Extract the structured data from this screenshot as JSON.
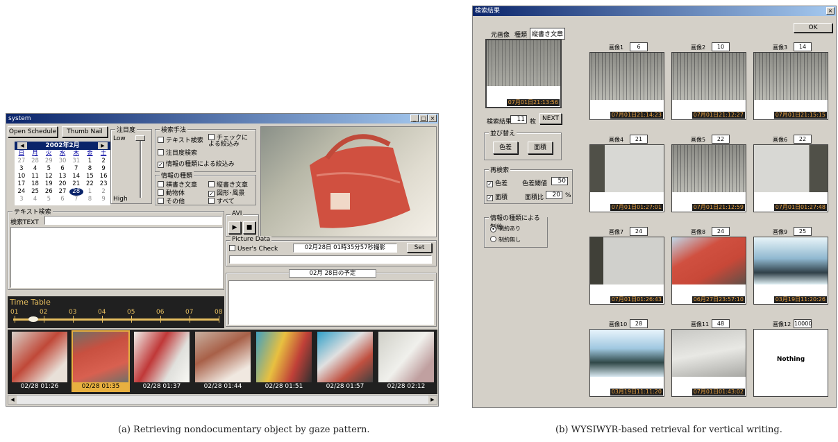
{
  "window_a": {
    "title": "system",
    "buttons": {
      "open_schedule": "Open Schedule",
      "thumb_nail": "Thumb Nail",
      "set": "Set"
    },
    "calendar": {
      "month": "2002年2月",
      "weekdays": [
        "日",
        "月",
        "火",
        "水",
        "木",
        "金",
        "土"
      ],
      "days": [
        "27",
        "28",
        "29",
        "30",
        "31",
        "1",
        "2",
        "3",
        "4",
        "5",
        "6",
        "7",
        "8",
        "9",
        "10",
        "11",
        "12",
        "13",
        "14",
        "15",
        "16",
        "17",
        "18",
        "19",
        "20",
        "21",
        "22",
        "23",
        "24",
        "25",
        "26",
        "27",
        "28",
        "1",
        "2",
        "3",
        "4",
        "5",
        "6",
        "7",
        "8",
        "9"
      ]
    },
    "attention": {
      "label": "注目度",
      "low": "Low",
      "high": "High"
    },
    "search_method": {
      "label": "検索手法",
      "text_search": "テキスト検索",
      "check_filter": "チェックに よる絞込み",
      "attention_search": "注目度検索",
      "info_type_filter": "情報の種類による絞込み"
    },
    "info_type": {
      "label": "情報の種類",
      "horizontal": "横書き文章",
      "vertical": "縦書き文章",
      "animal": "動物体",
      "figure": "図形･風景",
      "other": "その他",
      "all": "すべて"
    },
    "text_search": {
      "label": "テキスト検索",
      "field_label": "検索TEXT",
      "value": ""
    },
    "avi": {
      "label": "AVI"
    },
    "picture_data": {
      "label": "Picture Data",
      "users_check": "User's Check",
      "datetime": "02月28日 01時35分57秒撮影"
    },
    "schedule": {
      "title": "02月 28日の予定"
    },
    "timetable": {
      "label": "Time Table",
      "hours": [
        "01",
        "02",
        "03",
        "04",
        "05",
        "06",
        "07",
        "08"
      ]
    },
    "thumbnails": [
      "02/28 01:26",
      "02/28 01:35",
      "02/28 01:37",
      "02/28 01:44",
      "02/28 01:51",
      "02/28 01:57",
      "02/28 02:12"
    ]
  },
  "window_b": {
    "title": "検索結果",
    "ok": "OK",
    "source": {
      "tab_original": "元画像",
      "tab_type": "種類",
      "type_value": "縦書き文章",
      "timestamp": "07月01日21:13:56"
    },
    "result_count": {
      "label": "検索結果",
      "value": "11",
      "unit": "枚",
      "next": "NEXT"
    },
    "sort": {
      "label": "並び替え",
      "color": "色差",
      "area": "面積"
    },
    "research": {
      "label": "再検索",
      "color_diff": "色差",
      "color_thresh_label": "色差閾値",
      "color_thresh": "50",
      "area": "面積",
      "area_ratio_label": "面積比",
      "area_ratio": "20",
      "pct": "%"
    },
    "constraint": {
      "label": "情報の種類による制約",
      "with": "制約あり",
      "without": "制約無し"
    },
    "results": [
      {
        "label": "画像1",
        "score": "6",
        "ts": "07月01日21:14:23"
      },
      {
        "label": "画像2",
        "score": "10",
        "ts": "07月01日21:12:27"
      },
      {
        "label": "画像3",
        "score": "14",
        "ts": "07月01日21:15:15"
      },
      {
        "label": "画像4",
        "score": "21",
        "ts": "07月01日01:27:01"
      },
      {
        "label": "画像5",
        "score": "22",
        "ts": "07月01日21:12:59"
      },
      {
        "label": "画像6",
        "score": "22",
        "ts": "07月01日01:27:48"
      },
      {
        "label": "画像7",
        "score": "24",
        "ts": "07月01日01:26:43"
      },
      {
        "label": "画像8",
        "score": "24",
        "ts": "06月27日23:57:10"
      },
      {
        "label": "画像9",
        "score": "25",
        "ts": "03月19日11:20:26"
      },
      {
        "label": "画像10",
        "score": "28",
        "ts": "03月19日11:11:20"
      },
      {
        "label": "画像11",
        "score": "48",
        "ts": "07月01日01:43:02"
      },
      {
        "label": "画像12",
        "score": "10000",
        "ts": "",
        "empty_text": "Nothing"
      }
    ]
  },
  "captions": {
    "a": "(a) Retrieving nondocumentary object by gaze pattern.",
    "b": "(b) WYSIWYR-based retrieval for vertical writing."
  },
  "colors": {
    "titlebar": "#0a246a",
    "window_bg": "#d4d0c8",
    "timestamp": "#e8a040",
    "bag_red": "#d05040"
  }
}
